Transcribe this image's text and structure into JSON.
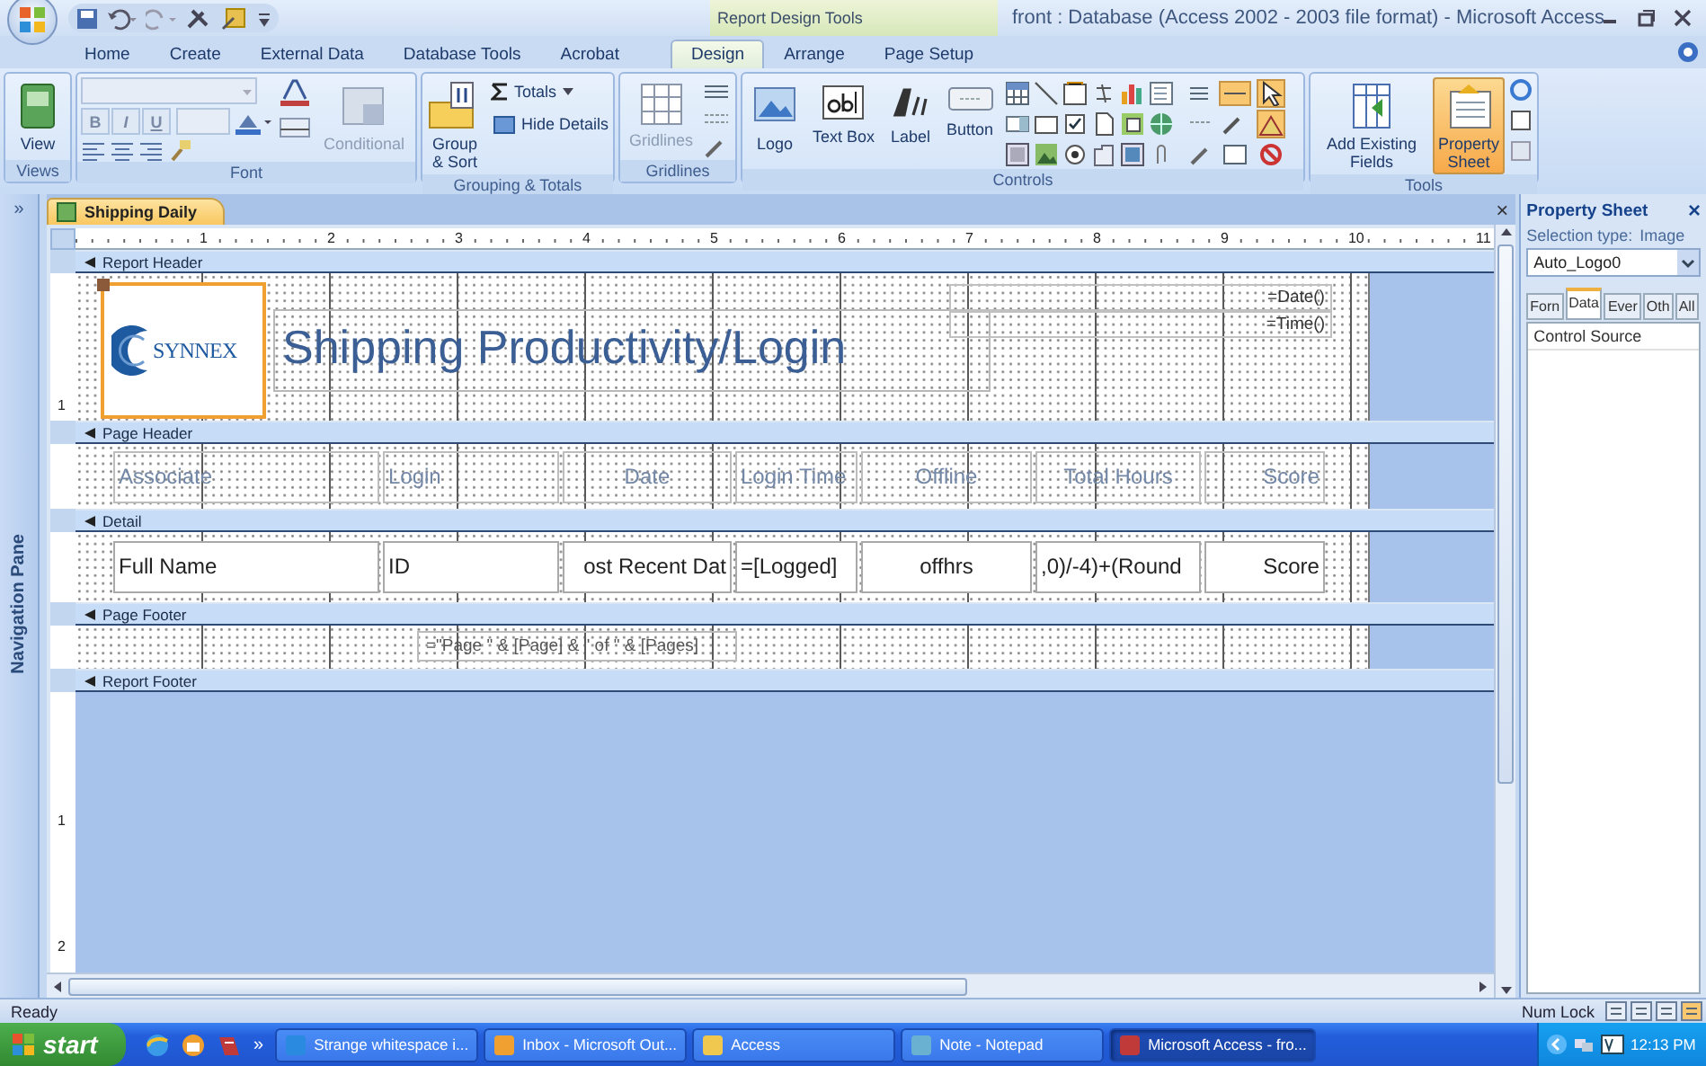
{
  "title_bar": {
    "context_label": "Report Design Tools",
    "title": "front : Database (Access 2002 - 2003 file format) - Microsoft Access"
  },
  "ribbon_tabs": [
    {
      "label": "Home",
      "selected": false
    },
    {
      "label": "Create",
      "selected": false
    },
    {
      "label": "External Data",
      "selected": false
    },
    {
      "label": "Database Tools",
      "selected": false
    },
    {
      "label": "Acrobat",
      "selected": false
    },
    {
      "label": "Design",
      "selected": true
    },
    {
      "label": "Arrange",
      "selected": false
    },
    {
      "label": "Page Setup",
      "selected": false
    }
  ],
  "ribbon_groups": [
    {
      "kind": "views",
      "label": "Views",
      "buttons": [
        {
          "kind": "large",
          "label": "View",
          "disabled": false,
          "selected": false
        }
      ]
    },
    {
      "kind": "font",
      "label": "Font",
      "buttons": [
        {
          "kind": "format",
          "label": "B",
          "disabled": true
        },
        {
          "kind": "format",
          "label": "I",
          "disabled": true
        },
        {
          "kind": "format",
          "label": "U",
          "disabled": true
        },
        {
          "kind": "large",
          "label": "Conditional",
          "disabled": true,
          "selected": false
        }
      ]
    },
    {
      "kind": "grouping",
      "label": "Grouping & Totals",
      "buttons": [
        {
          "kind": "large",
          "label": "Group & Sort",
          "disabled": false,
          "selected": false
        },
        {
          "kind": "small",
          "label": "Totals"
        },
        {
          "kind": "small",
          "label": "Hide Details"
        }
      ]
    },
    {
      "kind": "gridlines",
      "label": "Gridlines",
      "buttons": [
        {
          "kind": "large",
          "label": "Gridlines",
          "disabled": true,
          "selected": false
        }
      ]
    },
    {
      "kind": "controls",
      "label": "Controls",
      "buttons": [
        {
          "kind": "large",
          "label": "Logo",
          "disabled": false,
          "selected": false
        },
        {
          "kind": "large",
          "label": "Text Box",
          "disabled": false,
          "selected": false
        },
        {
          "kind": "large",
          "label": "Label",
          "disabled": false,
          "selected": false
        },
        {
          "kind": "large",
          "label": "Button",
          "disabled": false,
          "selected": false
        }
      ]
    },
    {
      "kind": "tools",
      "label": "Tools",
      "buttons": [
        {
          "kind": "large",
          "label": "Add Existing Fields",
          "disabled": false,
          "selected": false
        },
        {
          "kind": "large",
          "label": "Property Sheet",
          "disabled": false,
          "selected": true
        }
      ]
    }
  ],
  "navigation_pane": {
    "toggle": "»",
    "label": "Navigation Pane"
  },
  "report": {
    "tab": "Shipping Daily",
    "close": "×",
    "ruler_marks": [
      "1",
      "2",
      "3",
      "4",
      "5",
      "6",
      "7",
      "8",
      "9",
      "10",
      "11"
    ],
    "sections": [
      {
        "kind": "report_header",
        "label": "Report Header",
        "ruler_mark": "1",
        "logo": {
          "text": "SYNNEX",
          "selected": true
        },
        "title": "Shipping Productivity/Login",
        "expressions": [
          "=Date()",
          "=Time()"
        ]
      },
      {
        "kind": "header_columns",
        "label": "Page Header",
        "cells": [
          "Associate",
          "Login",
          "Date",
          "Login Time",
          "Offline",
          "Total Hours",
          "Score"
        ]
      },
      {
        "kind": "detail_columns",
        "label": "Detail",
        "cells": [
          "Full Name",
          "ID",
          "ost Recent Dat",
          "=[Logged]",
          "offhrs",
          ",0)/-4)+(Round",
          "Score"
        ]
      },
      {
        "kind": "footer",
        "label": "Page Footer",
        "expression": "=\"Page \" & [Page] & \" of \" & [Pages]"
      },
      {
        "kind": "empty",
        "label": "Report Footer"
      }
    ],
    "canvas_ruler_marks": [
      "1",
      "2"
    ]
  },
  "property_sheet": {
    "title": "Property Sheet",
    "close": "×",
    "selection_label": "Selection type:",
    "selection_type": "Image",
    "object": "Auto_Logo0",
    "tabs": [
      {
        "label": "Forn",
        "selected": false
      },
      {
        "label": "Data",
        "selected": true
      },
      {
        "label": "Ever",
        "selected": false
      },
      {
        "label": "Oth",
        "selected": false
      },
      {
        "label": "All",
        "selected": false
      }
    ],
    "properties": [
      "Control Source"
    ]
  },
  "status_bar": {
    "status": "Ready",
    "indicator": "Num Lock"
  },
  "taskbar": {
    "start": "start",
    "overflow": "»",
    "items": [
      {
        "label": "Strange whitespace i...",
        "selected": false
      },
      {
        "label": "Inbox - Microsoft Out...",
        "selected": false
      },
      {
        "label": "Access",
        "selected": false
      },
      {
        "label": "Note - Notepad",
        "selected": false
      },
      {
        "label": "Microsoft Access - fro...",
        "selected": true
      }
    ],
    "clock": "12:13 PM"
  }
}
